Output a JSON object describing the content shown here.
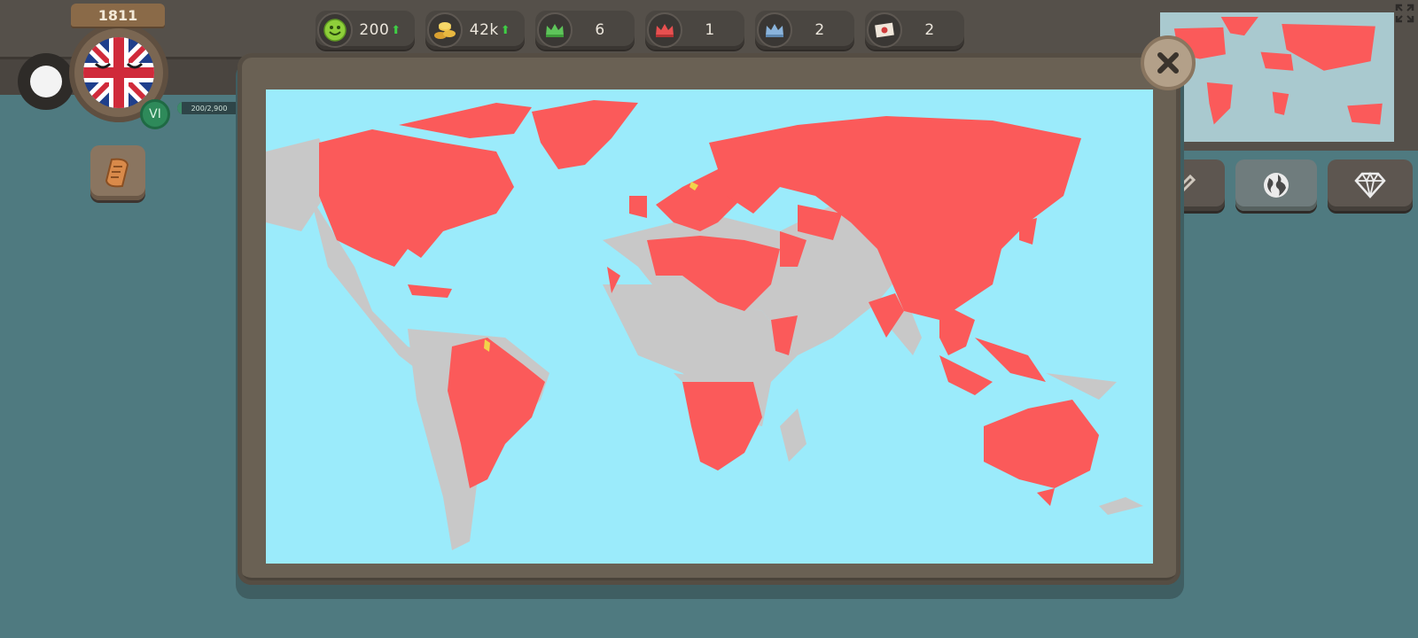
{
  "player": {
    "year": "1811",
    "rank": "VI",
    "xp_text": "200/2,900",
    "xp_fraction": 0.07
  },
  "resources": [
    {
      "id": "happiness",
      "icon": "smiley-icon",
      "value": "200",
      "trend": "up"
    },
    {
      "id": "gold",
      "icon": "coins-icon",
      "value": "42k",
      "trend": "up"
    },
    {
      "id": "allies",
      "icon": "green-crown-icon",
      "value": "6",
      "trend": ""
    },
    {
      "id": "enemies",
      "icon": "red-crown-icon",
      "value": "1",
      "trend": ""
    },
    {
      "id": "vassals",
      "icon": "blue-crown-icon",
      "value": "2",
      "trend": ""
    },
    {
      "id": "treaties",
      "icon": "letter-icon",
      "value": "2",
      "trend": ""
    }
  ],
  "map": {
    "owned_color": "#fb5a5a",
    "other_color": "#c8c8c8",
    "ocean_color": "#9bebfb",
    "contested_color": "#f2d34a"
  },
  "colors": {
    "up_arrow": "#3fcf45",
    "rank_badge": "#2e8a5a"
  },
  "icons": {
    "close": "close-icon",
    "expand": "expand-icon",
    "scroll": "scroll-icon",
    "edit": "pencil-icon",
    "globe": "globe-icon",
    "diamond": "diamond-icon"
  }
}
